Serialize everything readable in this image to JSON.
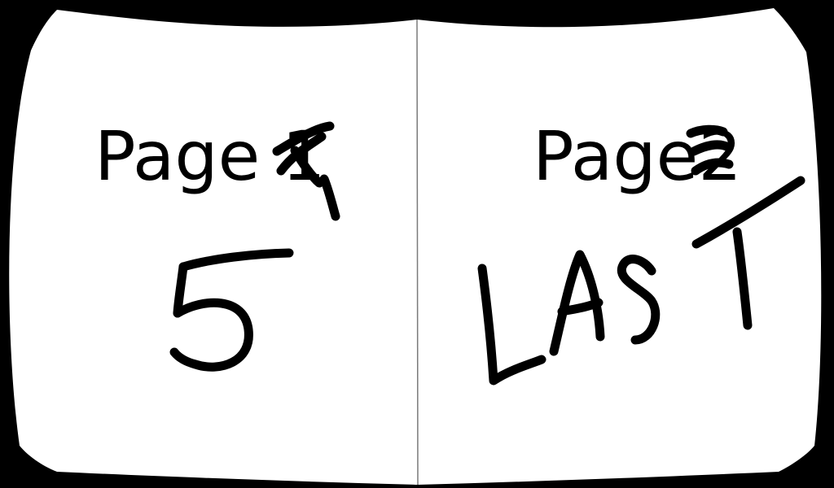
{
  "book": {
    "left_page": {
      "label_prefix": "Page ",
      "printed_number": "1",
      "handwritten_overwrite": "5"
    },
    "right_page": {
      "label_prefix": "Page",
      "printed_number": "2",
      "handwritten_overwrite": "LAST"
    }
  },
  "colors": {
    "background": "#000000",
    "page": "#ffffff",
    "ink": "#000000",
    "spine": "#7a7a7a"
  }
}
